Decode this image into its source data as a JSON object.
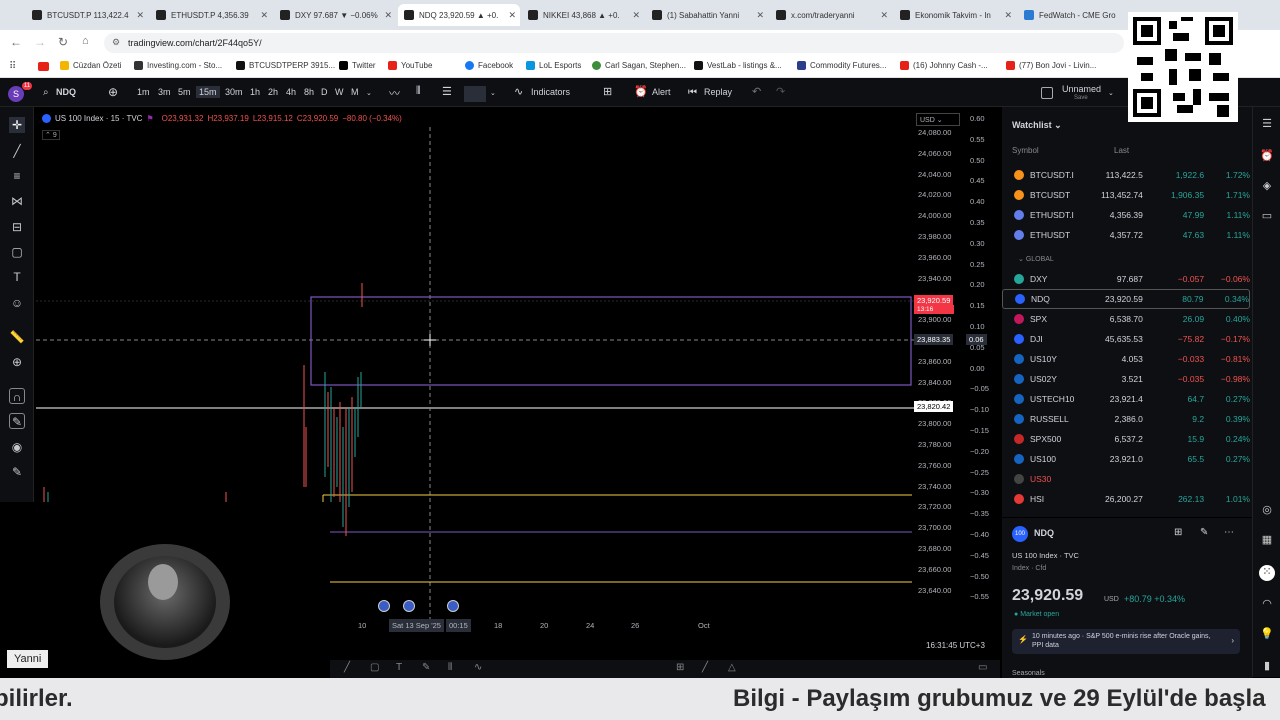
{
  "tabs": [
    {
      "label": "BTCUSDT.P 113,422.4"
    },
    {
      "label": "ETHUSDT.P 4,356.39"
    },
    {
      "label": "DXY 97.687 ▼ −0.06%"
    },
    {
      "label": "NDQ 23,920.59 ▲ +0."
    },
    {
      "label": "NIKKEI 43,868 ▲ +0."
    },
    {
      "label": "(1) Sabahattin Yanni"
    },
    {
      "label": "x.com/traderyanni"
    },
    {
      "label": "Ekonomik Takvim - In"
    },
    {
      "label": "FedWatch - CME Gro"
    }
  ],
  "url": "tradingview.com/chart/2F44qo5Y/",
  "bookmarks": [
    "Cüzdan Özeti",
    "Investing.com - Sto...",
    "BTCUSDTPERP 3915...",
    "Twitter",
    "YouTube",
    "Facebook",
    "LoL Esports",
    "Carl Sagan, Stephen...",
    "VestLab - listings &...",
    "Commodity Futures...",
    "(16) Johnny Cash -...",
    "(77) Bon Jovi - Livin..."
  ],
  "toolbar": {
    "symbol": "NDQ",
    "intervals": [
      "1m",
      "3m",
      "5m",
      "15m",
      "30m",
      "1h",
      "2h",
      "4h",
      "8h",
      "D",
      "W",
      "M"
    ],
    "indicators": "Indicators",
    "alert": "Alert",
    "replay": "Replay",
    "layout_name": "Unnamed",
    "layout_sub": "Save"
  },
  "legend": {
    "title": "US 100 Index · 15 · TVC",
    "o": "O23,931.32",
    "h": "H23,937.19",
    "l": "L23,915.12",
    "c": "C23,920.59",
    "chg": "−80.80 (−0.34%)",
    "count": "9"
  },
  "currency": "USD",
  "price_axis": [
    "24,080.00",
    "24,060.00",
    "24,040.00",
    "24,020.00",
    "24,000.00",
    "23,980.00",
    "23,960.00",
    "23,940.00",
    "23,920.00",
    "23,900.00",
    "23,880.00",
    "23,860.00",
    "23,840.00",
    "23,820.00",
    "23,800.00",
    "23,780.00",
    "23,760.00",
    "23,740.00",
    "23,720.00",
    "23,700.00",
    "23,680.00",
    "23,660.00",
    "23,640.00"
  ],
  "pct_axis": [
    "0.60",
    "0.55",
    "0.50",
    "0.45",
    "0.40",
    "0.35",
    "0.30",
    "0.25",
    "0.20",
    "0.15",
    "0.10",
    "0.05",
    "0.00",
    "−0.05",
    "−0.10",
    "−0.15",
    "−0.20",
    "−0.25",
    "−0.30",
    "−0.35",
    "−0.40",
    "−0.45",
    "−0.50",
    "−0.55"
  ],
  "price_tag": {
    "value": "23,920.59",
    "countdown": "13:16"
  },
  "cross_tag": {
    "value": "23,883.35",
    "pct": "0.06"
  },
  "line_tag": {
    "value": "23,820.42"
  },
  "time_axis": [
    "10",
    "Sat 13 Sep '25",
    "00:15",
    "18",
    "20",
    "24",
    "26",
    "Oct"
  ],
  "clock": "16:31:45 UTC+3",
  "watchlist": {
    "title": "Watchlist",
    "col_symbol": "Symbol",
    "col_last": "Last",
    "section": "GLOBAL",
    "rows": [
      {
        "sym": "BTCUSDT.I",
        "last": "113,422.5",
        "chg": "1,922.6",
        "pct": "1.72%",
        "dir": "up",
        "color": "#f7931a"
      },
      {
        "sym": "BTCUSDT",
        "last": "113,452.74",
        "chg": "1,906.35",
        "pct": "1.71%",
        "dir": "up",
        "color": "#f7931a"
      },
      {
        "sym": "ETHUSDT.I",
        "last": "4,356.39",
        "chg": "47.99",
        "pct": "1.11%",
        "dir": "up",
        "color": "#627eea"
      },
      {
        "sym": "ETHUSDT",
        "last": "4,357.72",
        "chg": "47.63",
        "pct": "1.11%",
        "dir": "up",
        "color": "#627eea"
      },
      {
        "sym": "DXY",
        "last": "97.687",
        "chg": "−0.057",
        "pct": "−0.06%",
        "dir": "dn",
        "color": "#26a69a"
      },
      {
        "sym": "NDQ",
        "last": "23,920.59",
        "chg": "80.79",
        "pct": "0.34%",
        "dir": "up",
        "color": "#2962ff"
      },
      {
        "sym": "SPX",
        "last": "6,538.70",
        "chg": "26.09",
        "pct": "0.40%",
        "dir": "up",
        "color": "#c2185b"
      },
      {
        "sym": "DJI",
        "last": "45,635.53",
        "chg": "−75.82",
        "pct": "−0.17%",
        "dir": "dn",
        "color": "#2962ff"
      },
      {
        "sym": "US10Y",
        "last": "4.053",
        "chg": "−0.033",
        "pct": "−0.81%",
        "dir": "dn",
        "color": "#1565c0"
      },
      {
        "sym": "US02Y",
        "last": "3.521",
        "chg": "−0.035",
        "pct": "−0.98%",
        "dir": "dn",
        "color": "#1565c0"
      },
      {
        "sym": "USTECH10",
        "last": "23,921.4",
        "chg": "64.7",
        "pct": "0.27%",
        "dir": "up",
        "color": "#1565c0"
      },
      {
        "sym": "RUSSELL",
        "last": "2,386.0",
        "chg": "9.2",
        "pct": "0.39%",
        "dir": "up",
        "color": "#1565c0"
      },
      {
        "sym": "SPX500",
        "last": "6,537.2",
        "chg": "15.9",
        "pct": "0.24%",
        "dir": "up",
        "color": "#c62828"
      },
      {
        "sym": "US100",
        "last": "23,921.0",
        "chg": "65.5",
        "pct": "0.27%",
        "dir": "up",
        "color": "#1565c0"
      },
      {
        "sym": "US30",
        "last": "",
        "chg": "",
        "pct": "",
        "dir": "dn",
        "color": "#444"
      },
      {
        "sym": "HSI",
        "last": "26,200.27",
        "chg": "262.13",
        "pct": "1.01%",
        "dir": "up",
        "color": "#e53935"
      }
    ]
  },
  "detail": {
    "symbol": "NDQ",
    "name": "US 100 Index · TVC",
    "type": "Index · Cfd",
    "price": "23,920.59",
    "currency": "USD",
    "change": "+80.79 +0.34%",
    "status": "Market open",
    "news": "10 minutes ago · S&P 500 e-minis rise after Oracle gains, PPI data",
    "seasonals": "Seasonals"
  },
  "webcam_name": "Yanni",
  "caption_left": "bilirler.",
  "caption_right": "Bilgi - Paylaşım grubumuz ve 29 Eylül'de başla"
}
